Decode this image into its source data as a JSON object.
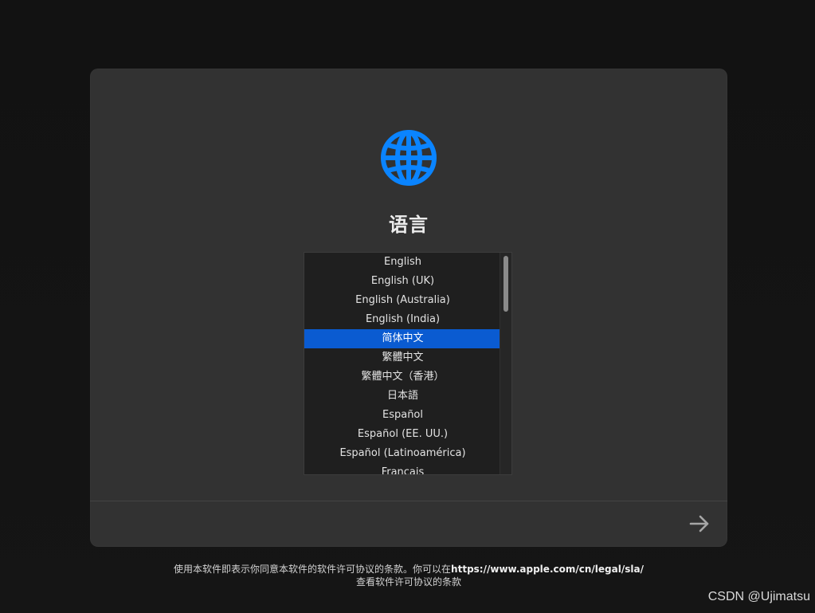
{
  "panel": {
    "title": "语言",
    "icon": "globe-icon",
    "accent_color": "#0a84ff",
    "languages": [
      {
        "label": "English"
      },
      {
        "label": "English (UK)"
      },
      {
        "label": "English (Australia)"
      },
      {
        "label": "English (India)"
      },
      {
        "label": "简体中文",
        "selected": true
      },
      {
        "label": "繁體中文"
      },
      {
        "label": "繁體中文（香港）"
      },
      {
        "label": "日本語"
      },
      {
        "label": "Español"
      },
      {
        "label": "Español (EE. UU.)"
      },
      {
        "label": "Español (Latinoamérica)"
      },
      {
        "label": "Français"
      }
    ],
    "selected_color": "#0a5bd1",
    "next_icon": "arrow-right-icon"
  },
  "footer": {
    "line1_prefix": "使用本软件即表示你同意本软件的软件许可协议的条款。你可以在",
    "link": "https://www.apple.com/cn/legal/sla/",
    "line2": "查看软件许可协议的条款"
  },
  "watermark": "CSDN @Ujimatsu"
}
